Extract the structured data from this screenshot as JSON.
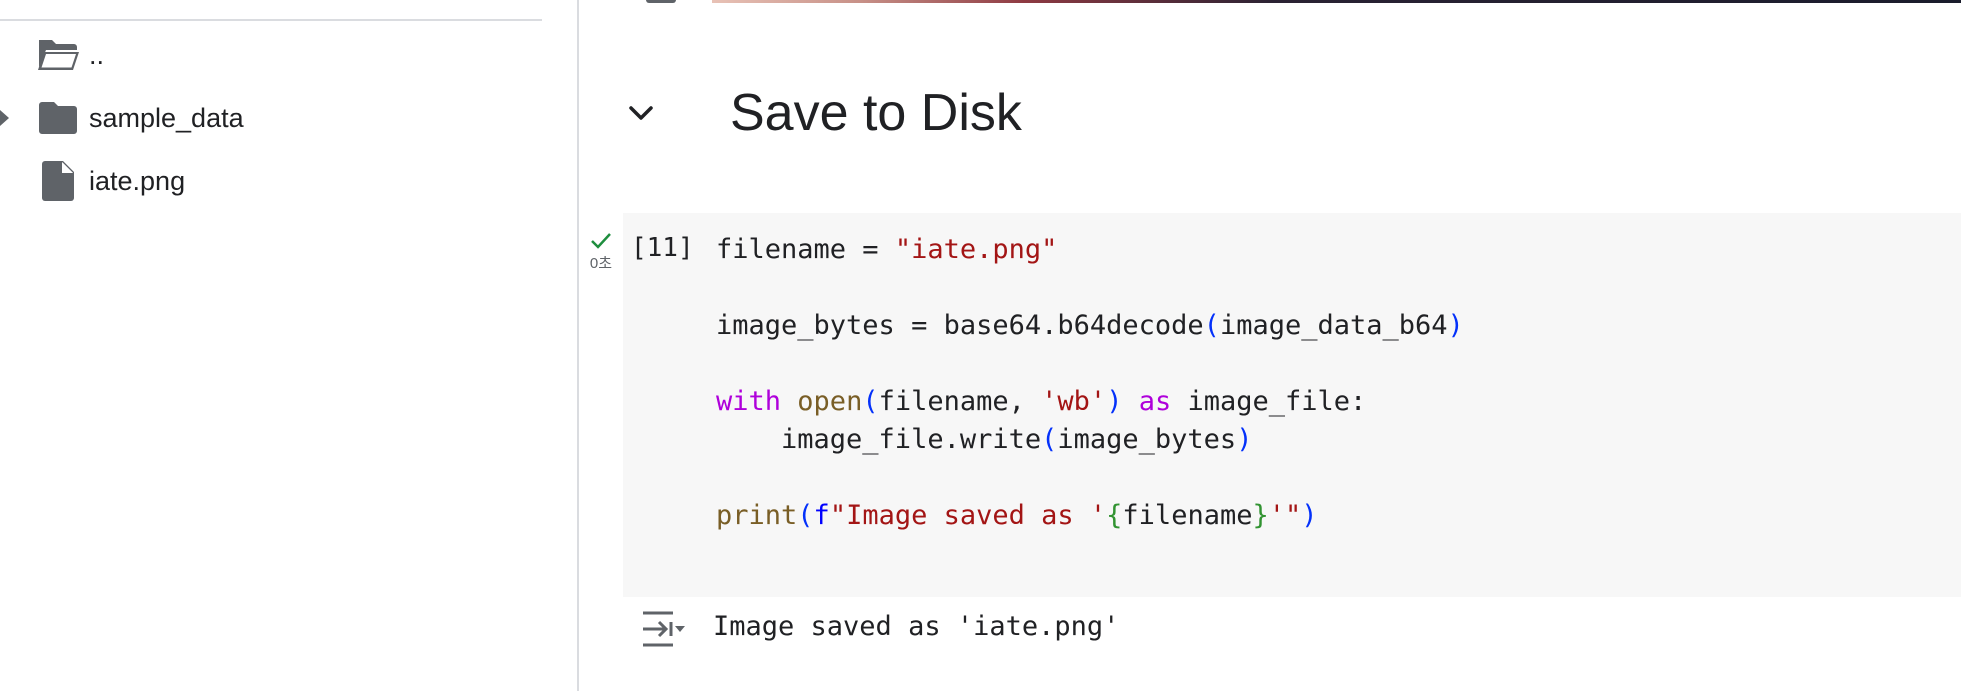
{
  "file_browser": {
    "items": [
      {
        "label": "..",
        "icon": "folder-open-icon",
        "expandable": false
      },
      {
        "label": "sample_data",
        "icon": "folder-icon",
        "expandable": true
      },
      {
        "label": "iate.png",
        "icon": "file-icon",
        "expandable": false
      }
    ]
  },
  "notebook": {
    "section": {
      "title": "Save to Disk",
      "toggle_icon": "chevron-down-icon"
    },
    "cell": {
      "execution_count": "[11]",
      "status_icon": "check-icon",
      "status_time": "0초",
      "code_lines": [
        "filename = \"iate.png\"",
        "",
        "image_bytes = base64.b64decode(image_data_b64)",
        "",
        "with open(filename, 'wb') as image_file:",
        "    image_file.write(image_bytes)",
        "",
        "print(f\"Image saved as '{filename}'\")"
      ],
      "output_icon": "output-toggle-icon",
      "output_text": "Image saved as 'iate.png'"
    }
  },
  "colors": {
    "string": "#a31515",
    "keyword": "#af00db",
    "builtin": "#795e26",
    "paren": "#0431fa",
    "brace": "#319331",
    "cell_background": "#f7f7f7",
    "check": "#1e8e3e",
    "icon": "#5f6368"
  }
}
